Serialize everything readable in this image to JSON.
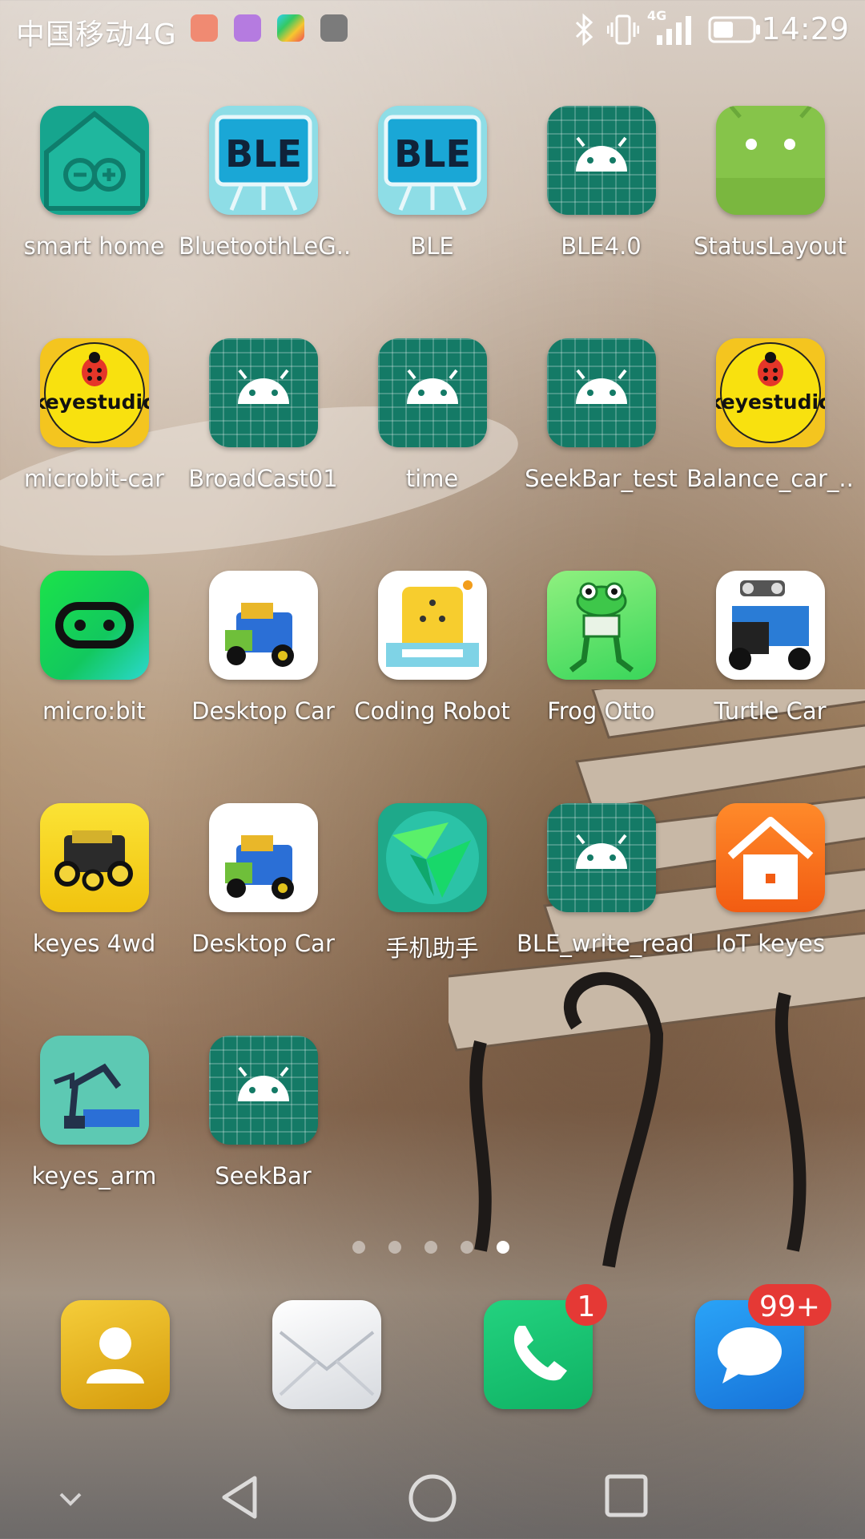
{
  "status_bar": {
    "carrier": "中国移动4G",
    "time": "14:29",
    "network": "4G"
  },
  "apps": [
    {
      "label": "smart home",
      "icon": "arduino-house-icon"
    },
    {
      "label": "BluetoothLeG..",
      "icon": "ble-board-icon"
    },
    {
      "label": "BLE",
      "icon": "ble-board-icon"
    },
    {
      "label": "BLE4.0",
      "icon": "android-icon"
    },
    {
      "label": "StatusLayout",
      "icon": "android-green-icon"
    },
    {
      "label": "microbit-car",
      "icon": "keyestudio-icon",
      "logo_text": "keyestudio"
    },
    {
      "label": "BroadCast01",
      "icon": "android-icon"
    },
    {
      "label": "time",
      "icon": "android-icon"
    },
    {
      "label": "SeekBar_test",
      "icon": "android-icon"
    },
    {
      "label": "Balance_car_..",
      "icon": "keyestudio-icon",
      "logo_text": "keyestudio"
    },
    {
      "label": "micro:bit",
      "icon": "microbit-icon"
    },
    {
      "label": "Desktop Car",
      "icon": "robot-car-icon"
    },
    {
      "label": "Coding Robot",
      "icon": "coding-robot-icon"
    },
    {
      "label": "Frog Otto",
      "icon": "frog-robot-icon"
    },
    {
      "label": "Turtle Car",
      "icon": "turtle-car-icon"
    },
    {
      "label": "keyes 4wd",
      "icon": "4wd-car-icon"
    },
    {
      "label": "Desktop Car",
      "icon": "robot-car-icon"
    },
    {
      "label": "手机助手",
      "icon": "phone-assistant-icon"
    },
    {
      "label": "BLE_write_read",
      "icon": "android-icon"
    },
    {
      "label": "IoT keyes",
      "icon": "iot-house-icon"
    },
    {
      "label": "keyes_arm",
      "icon": "robot-arm-icon"
    },
    {
      "label": "SeekBar",
      "icon": "android-icon"
    }
  ],
  "page_indicator": {
    "count": 5,
    "active": 5
  },
  "dock": [
    {
      "name": "contacts",
      "icon": "contacts-icon"
    },
    {
      "name": "email",
      "icon": "email-icon"
    },
    {
      "name": "phone",
      "icon": "phone-icon",
      "badge": "1"
    },
    {
      "name": "messages",
      "icon": "messages-icon",
      "badge": "99+"
    }
  ],
  "navbar": {
    "items": [
      "collapse-icon",
      "back-icon",
      "home-icon",
      "recents-icon"
    ]
  },
  "colors": {
    "android_tile": "#147a66",
    "badge": "#e53935",
    "phone_green": "#19c37a",
    "messages_blue": "#1d8ff0",
    "contacts_gold": "#e3b21a"
  }
}
